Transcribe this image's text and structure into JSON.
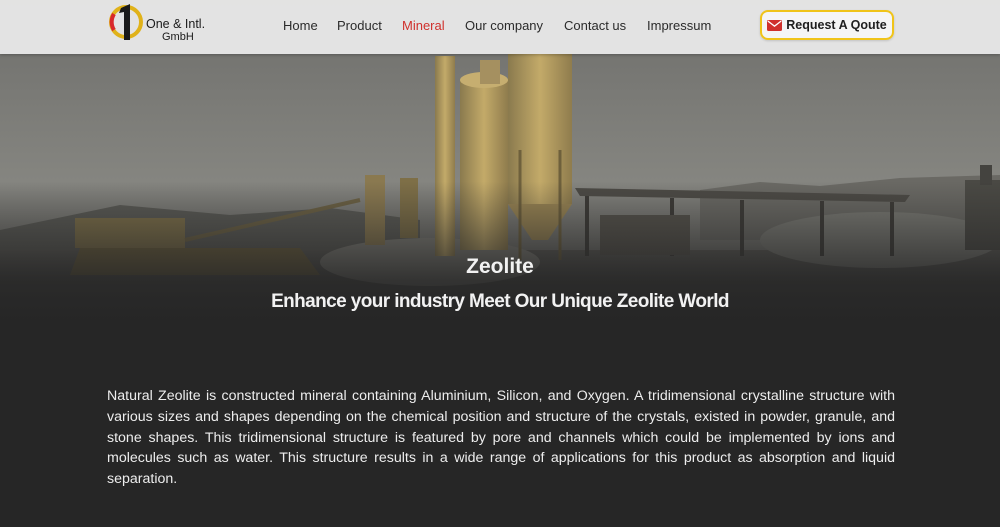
{
  "brand": {
    "mark": "1",
    "name_line1": "One & Intl.",
    "name_line2": "GmbH"
  },
  "nav": {
    "items": [
      {
        "label": "Home",
        "active": false
      },
      {
        "label": "Product",
        "active": false
      },
      {
        "label": "Mineral",
        "active": true
      },
      {
        "label": "Our company",
        "active": false
      },
      {
        "label": "Contact us",
        "active": false
      },
      {
        "label": "Impressum",
        "active": false
      }
    ],
    "active_color": "#d0312d"
  },
  "cta": {
    "icon": "envelope-icon",
    "label": "Request A Qoute",
    "border_color": "#f0c419"
  },
  "hero": {
    "title": "Zeolite",
    "subtitle": "Enhance your industry Meet Our Unique Zeolite World"
  },
  "main": {
    "intro": "Natural Zeolite is constructed mineral containing Aluminium, Silicon, and Oxygen. A tridimensional crystalline structure with various sizes and shapes depending on the chemical position and structure of the crystals, existed in powder, granule, and stone shapes. This tridimensional structure is featured by pore and channels which could be implemented by ions and molecules such as water. This structure results in a wide range of applications for this product as absorption and liquid separation."
  }
}
